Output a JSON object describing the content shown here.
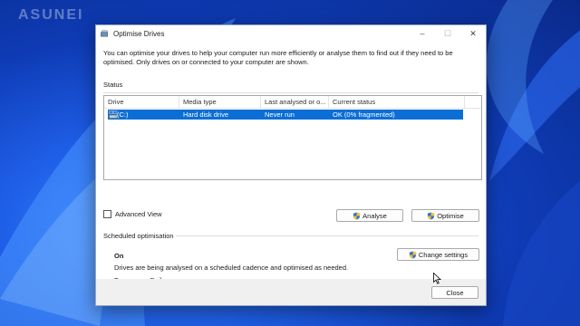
{
  "watermark": "ASUNEI",
  "window": {
    "title": "Optimise Drives",
    "controls": {
      "minimize": "–",
      "maximize": "☐",
      "close": "✕"
    }
  },
  "intro_text": "You can optimise your drives to help your computer run more efficiently or analyse them to find out if they need to be optimised. Only drives on or connected to your computer are shown.",
  "status_label": "Status",
  "drives_table": {
    "columns": [
      "Drive",
      "Media type",
      "Last analysed or o...",
      "Current status"
    ],
    "rows": [
      {
        "drive": "(C:)",
        "media_type": "Hard disk drive",
        "last_analysed": "Never run",
        "current_status": "OK (0% fragmented)",
        "selected": true
      }
    ]
  },
  "advanced_view_label": "Advanced View",
  "buttons": {
    "analyse": "Analyse",
    "optimise": "Optimise",
    "change_settings": "Change settings",
    "close": "Close"
  },
  "scheduled": {
    "label": "Scheduled optimisation",
    "state": "On",
    "description": "Drives are being analysed on a scheduled cadence and optimised as needed.",
    "frequency": "Frequency: Daily"
  },
  "colors": {
    "selection": "#0a6ed6",
    "wallpaper": "#1f5fe8"
  }
}
